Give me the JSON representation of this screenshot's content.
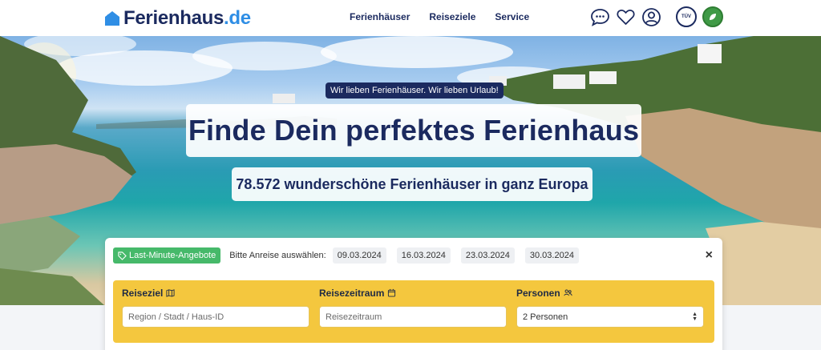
{
  "header": {
    "logo": {
      "name": "Ferienhaus",
      "tld": ".de",
      "icon": "house-icon"
    },
    "nav": [
      {
        "label": "Ferienhäuser"
      },
      {
        "label": "Reiseziele"
      },
      {
        "label": "Service"
      }
    ],
    "icons": [
      "chat-icon",
      "heart-icon",
      "user-icon"
    ],
    "badges": [
      {
        "name": "tuv-seal-badge",
        "text": "TÜV"
      },
      {
        "name": "green-seal-badge",
        "text": ""
      }
    ]
  },
  "hero": {
    "tagline": "Wir lieben Ferienhäuser. Wir lieben Urlaub!",
    "headline": "Finde Dein perfektes Ferienhaus",
    "subline": "78.572 wunderschöne Ferienhäuser in ganz Europa"
  },
  "search": {
    "last_minute_label": "Last-Minute-Angebote",
    "arrival_label": "Bitte Anreise auswählen:",
    "dates": [
      "09.03.2024",
      "16.03.2024",
      "23.03.2024",
      "30.03.2024"
    ],
    "close_label": "×",
    "fields": {
      "destination": {
        "label": "Reiseziel",
        "placeholder": "Region / Stadt / Haus-ID",
        "icon": "map-icon"
      },
      "period": {
        "label": "Reisezeitraum",
        "placeholder": "Reisezeitraum",
        "icon": "calendar-icon"
      },
      "persons": {
        "label": "Personen",
        "value": "2 Personen",
        "icon": "people-icon"
      }
    }
  },
  "colors": {
    "brand_navy": "#1b2a5f",
    "brand_blue": "#2f8ee5",
    "last_minute_green": "#46b96a",
    "search_yellow": "#f4c73e"
  }
}
